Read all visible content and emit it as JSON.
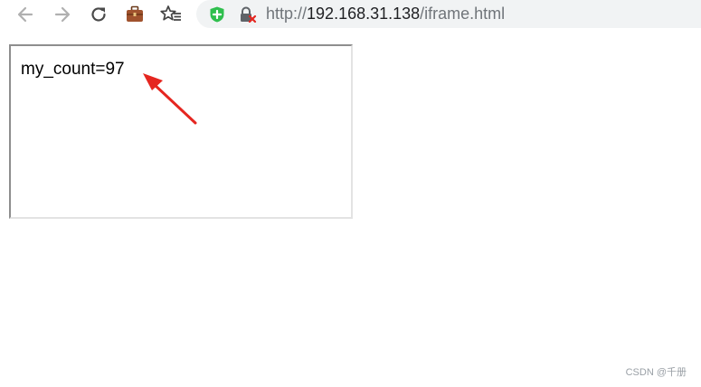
{
  "browser": {
    "icons": {
      "back": "back-arrow-icon",
      "forward": "forward-arrow-icon",
      "reload": "reload-icon",
      "extension": "briefcase-icon",
      "favorites": "favorites-star-icon",
      "security_shield": "shield-plus-icon",
      "not_secure": "lock-warning-icon"
    },
    "address": {
      "scheme": "http://",
      "host": "192.168.31.138",
      "path": "/iframe.html"
    }
  },
  "iframe": {
    "text": "my_count=97"
  },
  "annotation": {
    "color": "#e52620"
  },
  "watermark": "CSDN @千册"
}
